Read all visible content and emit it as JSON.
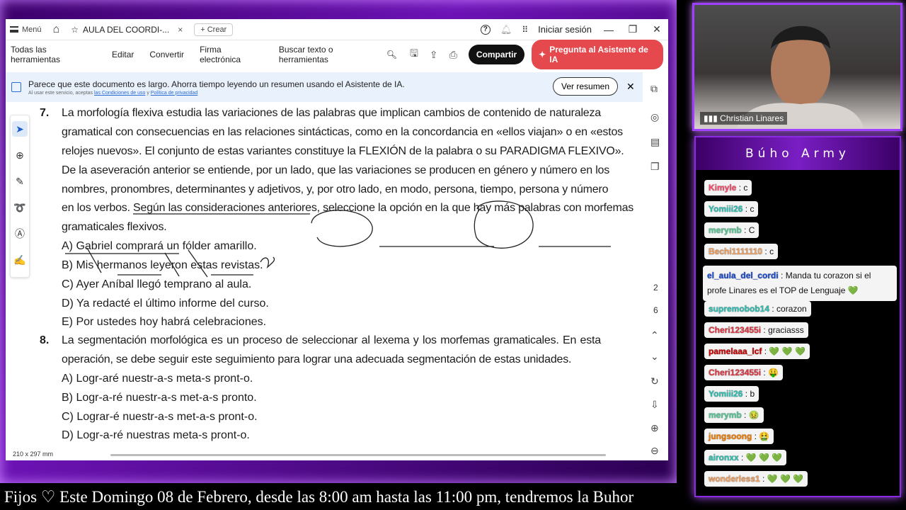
{
  "titlebar": {
    "menu_label": "Menú",
    "tab_title": "AULA DEL COORDI-...",
    "crear_label": "Crear",
    "signin_label": "Iniciar sesión"
  },
  "toolbar": {
    "all_tools": "Todas las herramientas",
    "edit": "Editar",
    "convert": "Convertir",
    "esign": "Firma electrónica",
    "search": "Buscar texto o herramientas",
    "share": "Compartir",
    "ai_assistant": "Pregunta al Asistente de IA"
  },
  "banner": {
    "text": "Parece que este documento es largo. Ahorra tiempo leyendo un resumen usando el Asistente de IA.",
    "legal_prefix": "Al usar este servicio, aceptas",
    "legal_terms": "las Condiciones de uso",
    "legal_and": "y",
    "legal_privacy": "Política de privacidad",
    "summary_button": "Ver resumen"
  },
  "document": {
    "q7_number": "7.",
    "q7_lines": [
      "La morfología flexiva estudia las variaciones de las palabras que implican cambios de contenido de naturaleza",
      "gramatical con consecuencias en las relaciones sintácticas, como en la concordancia en «ellos viajan» o en «estos",
      "relojes nuevos». El conjunto de estas variantes constituye la FLEXIÓN de la palabra o su PARADIGMA FLEXIVO».",
      "De la aseveración anterior se entiende, por un lado, que las variaciones se producen en género y número en los",
      "nombres, pronombres, determinantes y adjetivos, y, por otro lado, en modo, persona, tiempo, persona y número",
      "en los verbos. Según las consideraciones anteriores, seleccione la opción en la que hay más palabras con morfemas",
      "gramaticales flexivos."
    ],
    "q7_options": [
      "A) Gabriel comprará un fólder amarillo.",
      "B) Mis hermanos leyeron estas revistas.",
      "C) Ayer Aníbal llegó temprano al aula.",
      "D) Ya redacté el último informe del curso.",
      "E) Por ustedes hoy habrá celebraciones."
    ],
    "q8_number": "8.",
    "q8_lines": [
      "La segmentación morfológica es un proceso de seleccionar al lexema y los morfemas gramaticales. En esta",
      "operación, se debe seguir este seguimiento para lograr una adecuada segmentación de estas unidades."
    ],
    "q8_options": [
      "A) Logr-aré nuestr-a-s meta-s pront-o.",
      "B) Logr-a-ré nuestr-a-s met-a-s pronto.",
      "C) Lograr-é nuestr-a-s met-a-s pront-o.",
      "D) Logr-a-ré nuestras meta-s pront-o."
    ]
  },
  "page_indicator": {
    "current": "2",
    "total": "6"
  },
  "status": {
    "page_size": "210 x 297 mm"
  },
  "webcam": {
    "name": "Christian Linares"
  },
  "chat": {
    "title": "Búho Army",
    "messages": [
      {
        "user": "Kimyle",
        "text": ": c",
        "color": "#ff4d6d"
      },
      {
        "user": "Yomiii26",
        "text": ": c",
        "color": "#2ec4b6"
      },
      {
        "user": "merymb",
        "text": ": C",
        "color": "#57cc99"
      },
      {
        "user": "Bechi1111110",
        "text": ": c",
        "color": "#f4a261"
      },
      {
        "user": "el_aula_del_cordi",
        "text": ": Manda tu corazon si el profe Linares es el TOP de Lenguaje 💚",
        "color": "#1d4ed8"
      },
      {
        "user": "supremobob14",
        "text": ": corazon",
        "color": "#2ec4b6"
      },
      {
        "user": "Cheri123455i",
        "text": ": graciasss",
        "color": "#e63946"
      },
      {
        "user": "pamelaaa_lcf",
        "text": ": 💚 💚 💚",
        "color": "#d00000"
      },
      {
        "user": "Cheri123455i",
        "text": ": 🤑",
        "color": "#e63946"
      },
      {
        "user": "Yomiii26",
        "text": ": b",
        "color": "#2ec4b6"
      },
      {
        "user": "merymb",
        "text": ": 🤢",
        "color": "#57cc99"
      },
      {
        "user": "jungsoong",
        "text": ": 🤮",
        "color": "#f77f00"
      },
      {
        "user": "aironxx",
        "text": ": 💚 💚 💚",
        "color": "#2ec4b6"
      },
      {
        "user": "wonderless1",
        "text": ": 💚 💚 💚",
        "color": "#f4a261"
      }
    ]
  },
  "ticker": {
    "text": "Fijos ♡  Este Domingo 08 de Febrero, desde las 8:00 am hasta las 11:00 pm, tendremos la Buhor"
  }
}
